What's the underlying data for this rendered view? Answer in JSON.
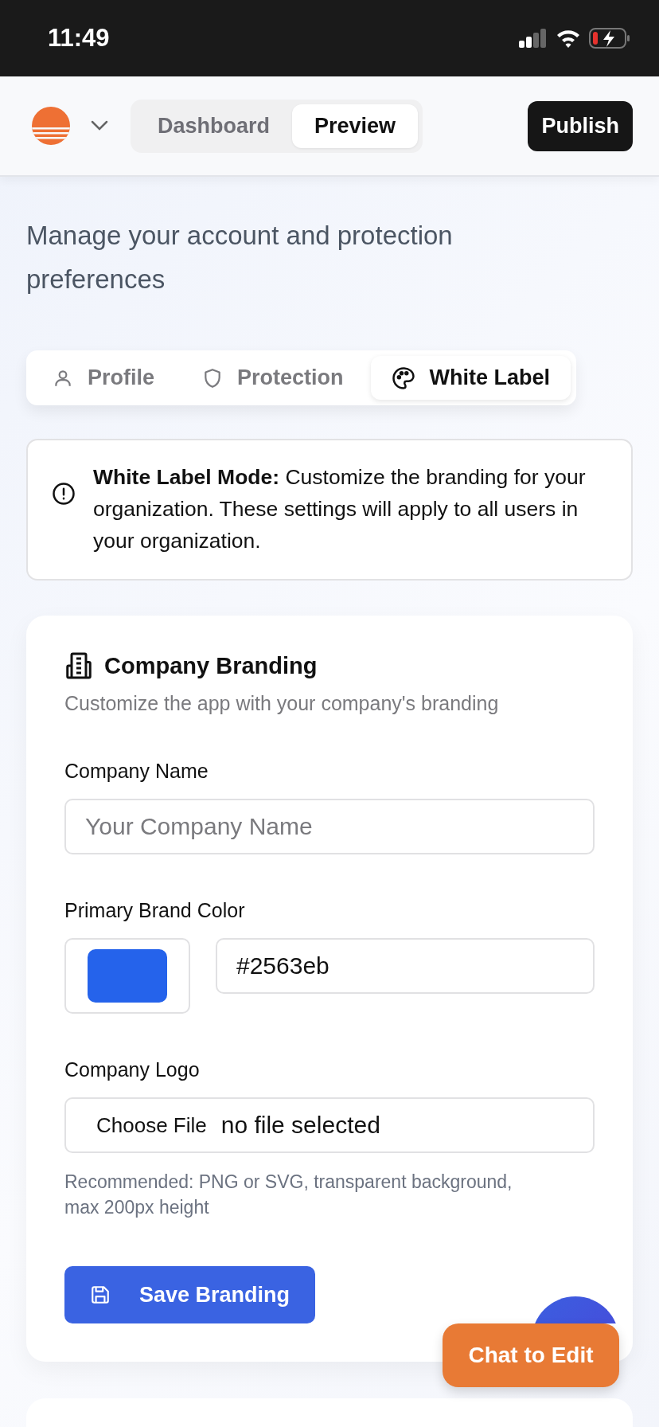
{
  "status_bar": {
    "time": "11:49"
  },
  "nav": {
    "tabs": [
      {
        "label": "Dashboard",
        "selected": false
      },
      {
        "label": "Preview",
        "selected": true
      }
    ],
    "publish_button": "Publish"
  },
  "header": {
    "subtitle": "Manage your account and protection preferences"
  },
  "settings_tabs": [
    {
      "label": "Profile",
      "kind": "user",
      "selected": false
    },
    {
      "label": "Protection",
      "kind": "shield",
      "selected": false
    },
    {
      "label": "White Label",
      "kind": "palette",
      "selected": true
    }
  ],
  "notice": {
    "text": "**White Label Mode:** Customize the branding for your organization. These settings will apply to all users in your organization."
  },
  "branding_card": {
    "title": "Company Branding",
    "subtitle": "Customize the app with your company's branding",
    "fields": [
      {
        "kind": "text",
        "label": "Company Name",
        "placeholder": "Your Company Name"
      },
      {
        "kind": "color",
        "label": "Primary Brand Color",
        "color": "#2563eb",
        "value": "#2563eb"
      },
      {
        "kind": "file",
        "label": "Company Logo",
        "button": "Choose File",
        "value": "no file selected",
        "hint": "Recommended: PNG or SVG, transparent background, max 200px height"
      }
    ],
    "save_button": "Save Branding"
  },
  "chat_button": "Chat to Edit"
}
